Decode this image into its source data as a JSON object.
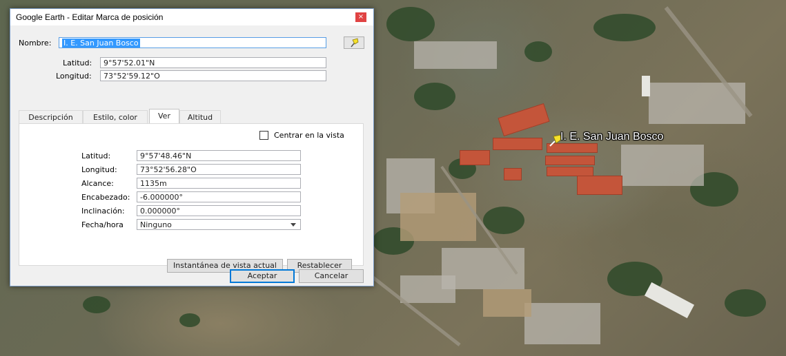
{
  "window": {
    "title": "Google Earth - Editar Marca de posición",
    "close_label": "×"
  },
  "placemark": {
    "name_label": "Nombre:",
    "name_value": "I. E. San Juan Bosco",
    "latitude_label": "Latitud:",
    "latitude_value": "9°57'52.01\"N",
    "longitude_label": "Longitud:",
    "longitude_value": "73°52'59.12\"O"
  },
  "tabs": [
    {
      "label": "Descripción"
    },
    {
      "label": "Estilo, color"
    },
    {
      "label": "Ver"
    },
    {
      "label": "Altitud"
    }
  ],
  "view_tab": {
    "center_label": "Centrar en la vista",
    "center_checked": false,
    "latitude_label": "Latitud:",
    "latitude_value": "9°57'48.46\"N",
    "longitude_label": "Longitud:",
    "longitude_value": "73°52'56.28\"O",
    "range_label": "Alcance:",
    "range_value": "1135m",
    "heading_label": "Encabezado:",
    "heading_value": "-6.000000°",
    "tilt_label": "Inclinación:",
    "tilt_value": "0.000000°",
    "datetime_label": "Fecha/hora",
    "datetime_value": "Ninguno",
    "snapshot_button": "Instantánea de vista actual",
    "reset_button": "Restablecer"
  },
  "footer": {
    "ok_button": "Aceptar",
    "cancel_button": "Cancelar"
  },
  "map": {
    "placemark_label": "I. E. San Juan Bosco",
    "pin_color": "#f5e12b"
  }
}
